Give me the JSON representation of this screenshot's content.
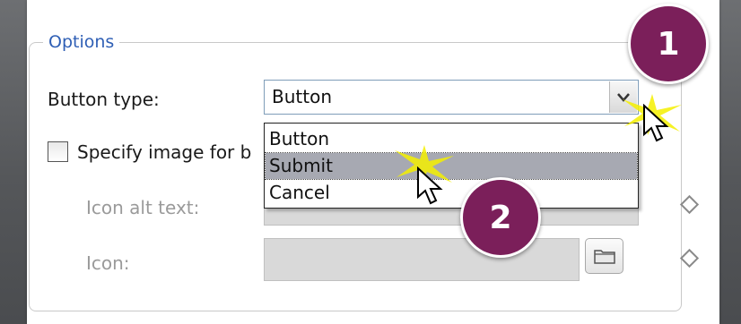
{
  "options_group": {
    "legend": "Options",
    "button_type_label": "Button type:",
    "button_type_value": "Button",
    "specify_image_label": "Specify image for b",
    "specify_image_checked": false,
    "icon_alt_text_label": "Icon alt text:",
    "icon_label": "Icon:"
  },
  "dropdown": {
    "options": [
      "Button",
      "Submit",
      "Cancel"
    ],
    "highlighted": "Submit"
  },
  "callouts": [
    "1",
    "2"
  ],
  "icons": {
    "dropdown_arrow": "chevron-down-icon",
    "browse": "folder-icon",
    "property_marker": "diamond-icon",
    "cursor": "mouse-pointer-icon"
  },
  "colors": {
    "legend_text": "#2f5fb5",
    "highlight": "#a7a9b2",
    "callout_fill": "#7b1f5a",
    "spark": "#f4f000"
  }
}
